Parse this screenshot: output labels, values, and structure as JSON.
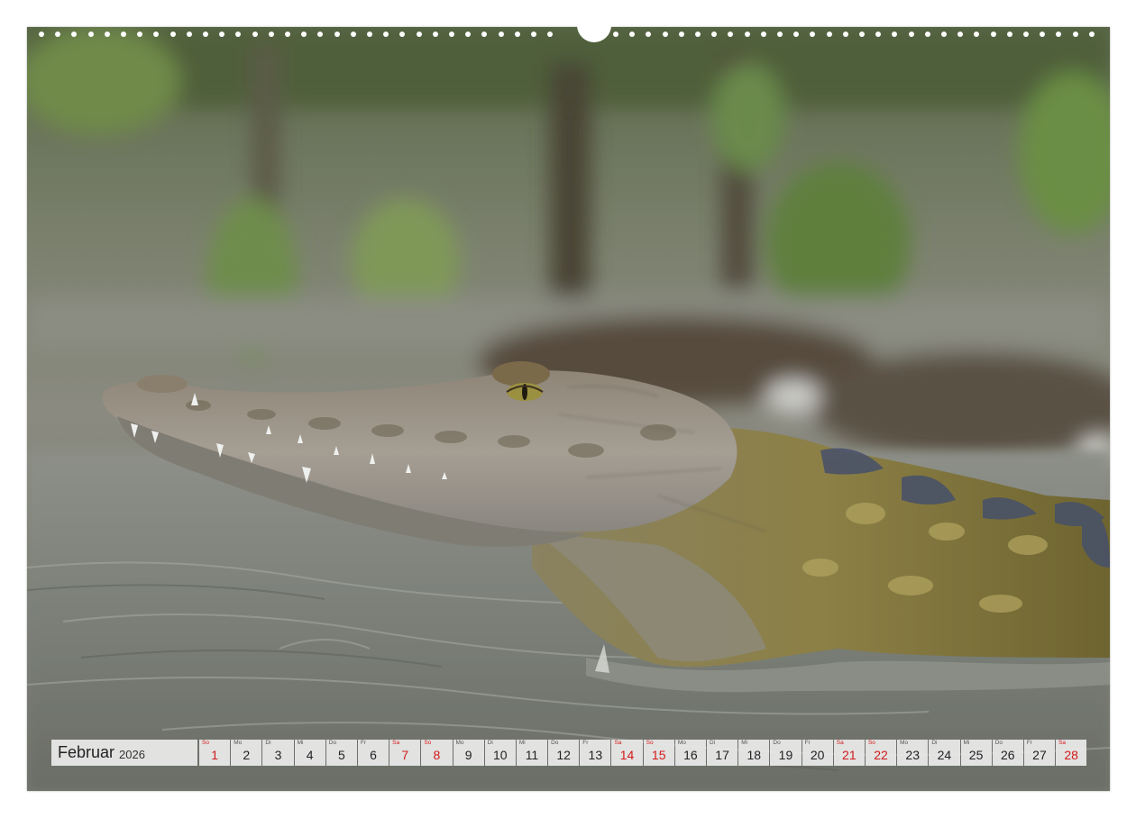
{
  "calendar": {
    "month": "Februar",
    "year": "2026",
    "days": [
      {
        "wd": "So",
        "d": "1",
        "weekend": true
      },
      {
        "wd": "Mo",
        "d": "2",
        "weekend": false
      },
      {
        "wd": "Di",
        "d": "3",
        "weekend": false
      },
      {
        "wd": "Mi",
        "d": "4",
        "weekend": false
      },
      {
        "wd": "Do",
        "d": "5",
        "weekend": false
      },
      {
        "wd": "Fr",
        "d": "6",
        "weekend": false
      },
      {
        "wd": "Sa",
        "d": "7",
        "weekend": true
      },
      {
        "wd": "So",
        "d": "8",
        "weekend": true
      },
      {
        "wd": "Mo",
        "d": "9",
        "weekend": false
      },
      {
        "wd": "Di",
        "d": "10",
        "weekend": false
      },
      {
        "wd": "Mi",
        "d": "11",
        "weekend": false
      },
      {
        "wd": "Do",
        "d": "12",
        "weekend": false
      },
      {
        "wd": "Fr",
        "d": "13",
        "weekend": false
      },
      {
        "wd": "Sa",
        "d": "14",
        "weekend": true
      },
      {
        "wd": "So",
        "d": "15",
        "weekend": true
      },
      {
        "wd": "Mo",
        "d": "16",
        "weekend": false
      },
      {
        "wd": "Di",
        "d": "17",
        "weekend": false
      },
      {
        "wd": "Mi",
        "d": "18",
        "weekend": false
      },
      {
        "wd": "Do",
        "d": "19",
        "weekend": false
      },
      {
        "wd": "Fr",
        "d": "20",
        "weekend": false
      },
      {
        "wd": "Sa",
        "d": "21",
        "weekend": true
      },
      {
        "wd": "So",
        "d": "22",
        "weekend": true
      },
      {
        "wd": "Mo",
        "d": "23",
        "weekend": false
      },
      {
        "wd": "Di",
        "d": "24",
        "weekend": false
      },
      {
        "wd": "Mi",
        "d": "25",
        "weekend": false
      },
      {
        "wd": "Do",
        "d": "26",
        "weekend": false
      },
      {
        "wd": "Fr",
        "d": "27",
        "weekend": false
      },
      {
        "wd": "Sa",
        "d": "28",
        "weekend": true
      }
    ]
  },
  "colors": {
    "weekend": "#d21a1a",
    "cell_background": "#ececec"
  }
}
